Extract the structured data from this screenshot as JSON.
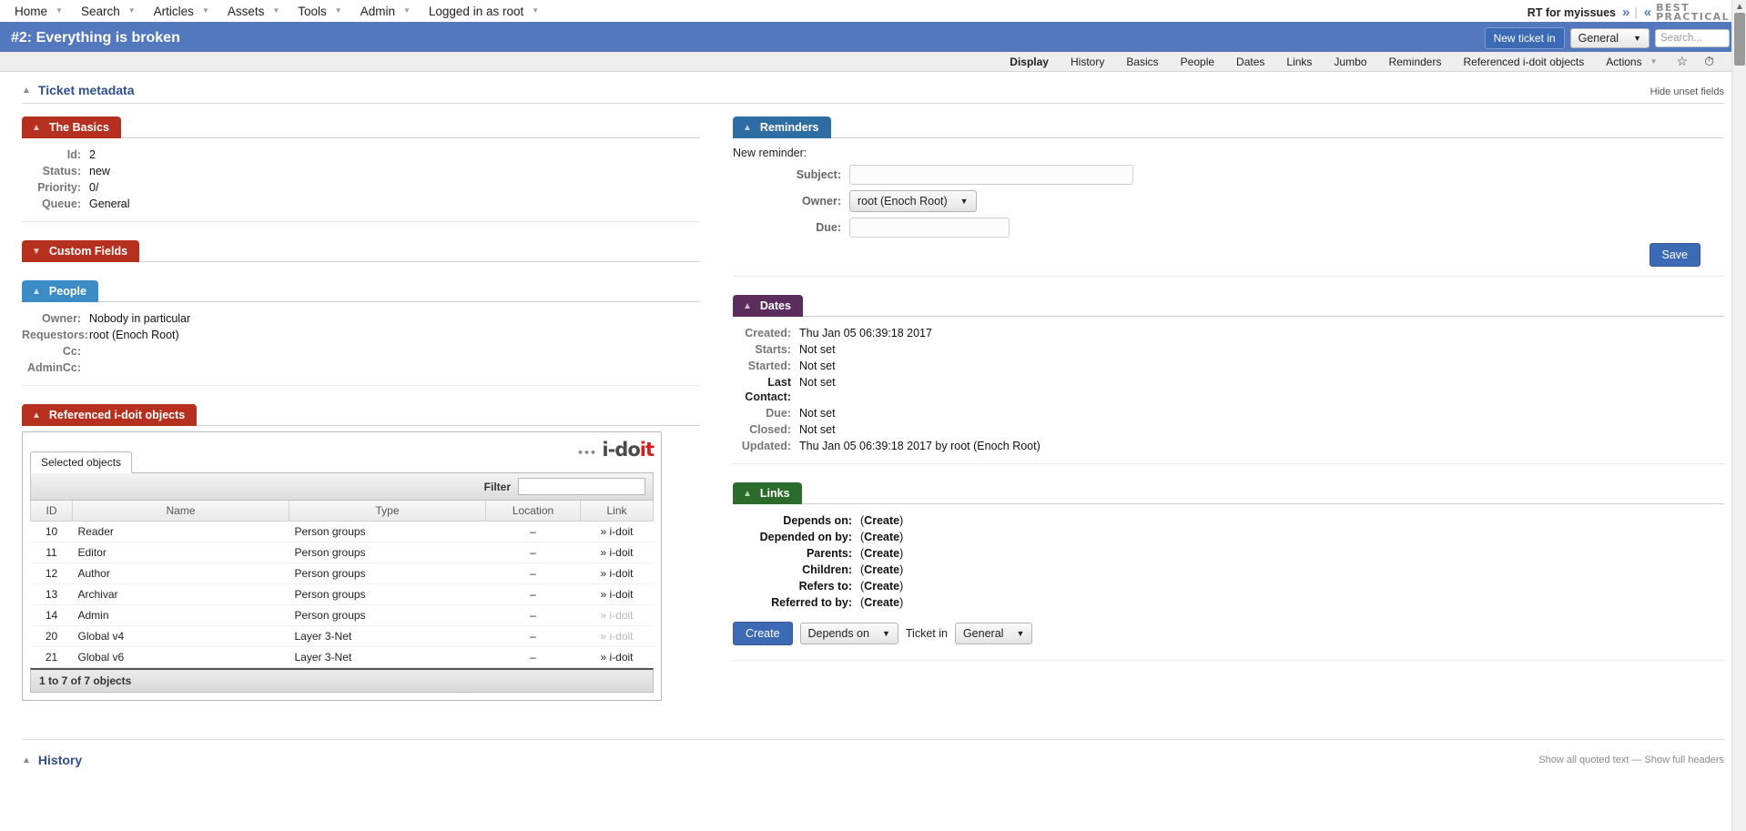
{
  "topnav": {
    "items": [
      {
        "label": "Home",
        "caret": true
      },
      {
        "label": "Search",
        "caret": true
      },
      {
        "label": "Articles",
        "caret": true
      },
      {
        "label": "Assets",
        "caret": true
      },
      {
        "label": "Tools",
        "caret": true
      },
      {
        "label": "Admin",
        "caret": true
      },
      {
        "label": "Logged in as root",
        "caret": true
      }
    ],
    "rt_name": "RT for myissues",
    "logo_line1": "BEST",
    "logo_line2": "PRACTICAL",
    "logo_tm": "™",
    "chevron_right": "»",
    "chevron_left": "«"
  },
  "titlebar": {
    "title": "#2: Everything is broken",
    "new_ticket_label": "New ticket in",
    "queue_value": "General",
    "search_placeholder": "Search..."
  },
  "tabs": [
    {
      "label": "Display",
      "active": true
    },
    {
      "label": "History",
      "active": false
    },
    {
      "label": "Basics",
      "active": false
    },
    {
      "label": "People",
      "active": false
    },
    {
      "label": "Dates",
      "active": false
    },
    {
      "label": "Links",
      "active": false
    },
    {
      "label": "Jumbo",
      "active": false
    },
    {
      "label": "Reminders",
      "active": false
    },
    {
      "label": "Referenced i-doit objects",
      "active": false
    },
    {
      "label": "Actions",
      "active": false,
      "caret": true
    }
  ],
  "tab_icons": {
    "star": "☆",
    "timer": "⏱"
  },
  "meta": {
    "section_title": "Ticket metadata",
    "hide_unset": "Hide unset fields",
    "collapse_icon": "⌃"
  },
  "basics": {
    "title": "The Basics",
    "rows": [
      {
        "label": "Id:",
        "value": "2"
      },
      {
        "label": "Status:",
        "value": "new"
      },
      {
        "label": "Priority:",
        "value": "0/"
      },
      {
        "label": "Queue:",
        "value": "General"
      }
    ]
  },
  "custom_fields": {
    "title": "Custom Fields",
    "collapsed": true
  },
  "people": {
    "title": "People",
    "rows": [
      {
        "label": "Owner:",
        "value": "Nobody in particular"
      },
      {
        "label": "Requestors:",
        "value": "root (Enoch Root)"
      },
      {
        "label": "Cc:",
        "value": ""
      },
      {
        "label": "AdminCc:",
        "value": ""
      }
    ]
  },
  "idoit": {
    "title": "Referenced i-doit objects",
    "logo_text": "i-do",
    "logo_accent": "it",
    "tab_label": "Selected objects",
    "filter_label": "Filter",
    "filter_value": "",
    "columns": [
      "ID",
      "Name",
      "Type",
      "Location",
      "Link"
    ],
    "rows": [
      {
        "id": "10",
        "name": "Reader",
        "type": "Person groups",
        "location": "–",
        "link": "» i-doit",
        "dim": false
      },
      {
        "id": "11",
        "name": "Editor",
        "type": "Person groups",
        "location": "–",
        "link": "» i-doit",
        "dim": false
      },
      {
        "id": "12",
        "name": "Author",
        "type": "Person groups",
        "location": "–",
        "link": "» i-doit",
        "dim": false
      },
      {
        "id": "13",
        "name": "Archivar",
        "type": "Person groups",
        "location": "–",
        "link": "» i-doit",
        "dim": false
      },
      {
        "id": "14",
        "name": "Admin",
        "type": "Person groups",
        "location": "–",
        "link": "» i-doit",
        "dim": true
      },
      {
        "id": "20",
        "name": "Global v4",
        "type": "Layer 3-Net",
        "location": "–",
        "link": "» i-doit",
        "dim": true
      },
      {
        "id": "21",
        "name": "Global v6",
        "type": "Layer 3-Net",
        "location": "–",
        "link": "» i-doit",
        "dim": false
      }
    ],
    "footer": "1 to 7 of 7 objects"
  },
  "reminders": {
    "title": "Reminders",
    "new_label": "New reminder:",
    "subject_label": "Subject:",
    "subject_value": "",
    "owner_label": "Owner:",
    "owner_value": "root (Enoch Root)",
    "due_label": "Due:",
    "due_value": "",
    "save_label": "Save"
  },
  "dates": {
    "title": "Dates",
    "rows": [
      {
        "label": "Created:",
        "value": "Thu Jan 05 06:39:18 2017",
        "bold": false
      },
      {
        "label": "Starts:",
        "value": "Not set",
        "bold": false
      },
      {
        "label": "Started:",
        "value": "Not set",
        "bold": false
      },
      {
        "label": "Last Contact:",
        "value": "Not set",
        "bold": true
      },
      {
        "label": "Due:",
        "value": "Not set",
        "bold": false
      },
      {
        "label": "Closed:",
        "value": "Not set",
        "bold": false
      },
      {
        "label": "Updated:",
        "value": "Thu Jan 05 06:39:18 2017 by root (Enoch Root)",
        "bold": false
      }
    ]
  },
  "links": {
    "title": "Links",
    "rows": [
      {
        "label": "Depends on:",
        "create": "Create"
      },
      {
        "label": "Depended on by:",
        "create": "Create"
      },
      {
        "label": "Parents:",
        "create": "Create"
      },
      {
        "label": "Children:",
        "create": "Create"
      },
      {
        "label": "Refers to:",
        "create": "Create"
      },
      {
        "label": "Referred to by:",
        "create": "Create"
      }
    ],
    "create_button": "Create",
    "relation_value": "Depends on",
    "ticket_in_label": "Ticket in",
    "queue_value": "General"
  },
  "history": {
    "title": "History",
    "show_quoted": "Show all quoted text",
    "separator": "—",
    "show_headers": "Show full headers"
  },
  "colors": {
    "accent_blue": "#5478be",
    "widget_blue": "#2e6da4",
    "widget_lightblue": "#3c8dc5",
    "widget_red": "#b6301f",
    "widget_purple": "#5a2d5c",
    "widget_green": "#2b6b2b"
  }
}
